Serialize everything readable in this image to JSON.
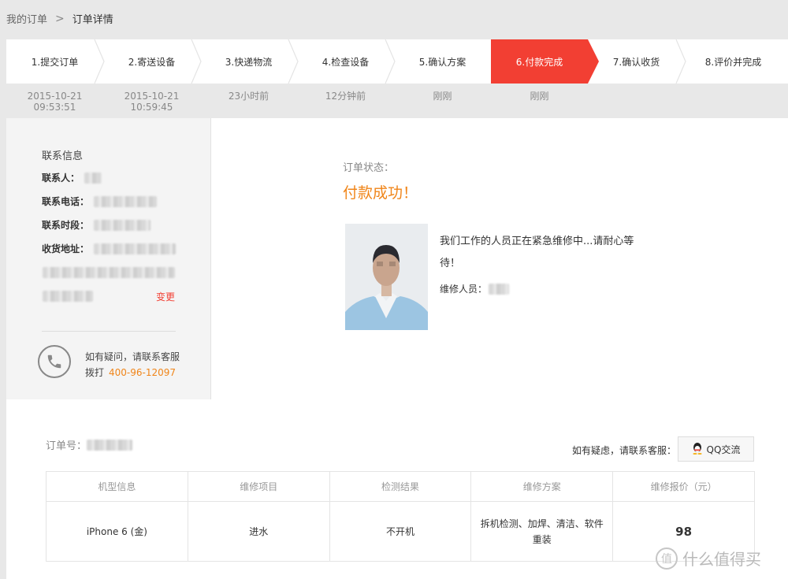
{
  "breadcrumb": {
    "parent": "我的订单",
    "current": "订单详情"
  },
  "steps": [
    {
      "label": "1.提交订单",
      "time1": "2015-10-21",
      "time2": "09:53:51"
    },
    {
      "label": "2.寄送设备",
      "time1": "2015-10-21",
      "time2": "10:59:45"
    },
    {
      "label": "3.快递物流",
      "time1": "23小时前",
      "time2": ""
    },
    {
      "label": "4.检查设备",
      "time1": "12分钟前",
      "time2": ""
    },
    {
      "label": "5.确认方案",
      "time1": "刚刚",
      "time2": ""
    },
    {
      "label": "6.付款完成",
      "time1": "刚刚",
      "time2": ""
    },
    {
      "label": "7.确认收货",
      "time1": "",
      "time2": ""
    },
    {
      "label": "8.评价并完成",
      "time1": "",
      "time2": ""
    }
  ],
  "active_step_index": 5,
  "contact": {
    "title": "联系信息",
    "person_label": "联系人：",
    "phone_label": "联系电话：",
    "period_label": "联系时段：",
    "address_label": "收货地址：",
    "change_link": "变更",
    "help_line": "如有疑问，请联系客服",
    "dial_label": "拨打",
    "hotline": "400-96-12097"
  },
  "status": {
    "label": "订单状态：",
    "value": "付款成功！",
    "message_line1": "我们工作的人员正在紧急维修中...请耐心等",
    "message_line2": "待！",
    "repairman_label": "维修人员："
  },
  "order": {
    "number_label": "订单号：",
    "doubt_text": "如有疑虑，请联系客服：",
    "qq_button": "QQ交流",
    "columns": [
      "机型信息",
      "维修项目",
      "检测结果",
      "维修方案",
      "维修报价（元）"
    ],
    "row": {
      "model": "iPhone 6 (金)",
      "item": "进水",
      "result": "不开机",
      "plan_line1": "拆机检测、加焊、清洁、软件",
      "plan_line2": "重装",
      "price": "98"
    }
  },
  "watermark": {
    "text": "什么值得买",
    "icon_char": "值"
  },
  "colors": {
    "accent": "#f23f33",
    "orange": "#f08519"
  }
}
